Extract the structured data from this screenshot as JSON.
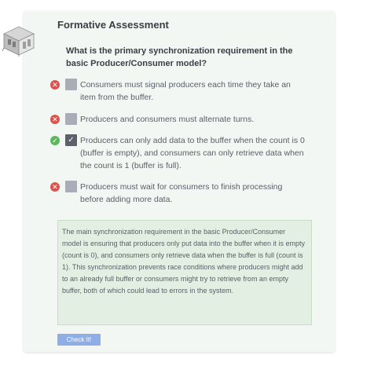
{
  "assessment": {
    "title": "Formative Assessment",
    "question": "What is the primary synchronization requirement in the basic Producer/Consumer model?",
    "options": [
      {
        "label": "Consumers must signal producers each time they take an item from the buffer.",
        "correct": false,
        "checked": false
      },
      {
        "label": "Producers and consumers must alternate turns.",
        "correct": false,
        "checked": false
      },
      {
        "label": "Producers can only add data to the buffer when the count is 0 (buffer is empty), and consumers can only retrieve data when the count is 1 (buffer is full).",
        "correct": true,
        "checked": true
      },
      {
        "label": "Producers must wait for consumers to finish processing before adding more data.",
        "correct": false,
        "checked": false
      }
    ],
    "explanation": "The main synchronization requirement in the basic Producer/Consumer model is ensuring that producers only put data into the buffer when it is empty (count is 0), and consumers only retrieve data when the buffer is full (count is 1). This synchronization prevents race conditions where producers might add to an already full buffer or consumers might try to retrieve from an empty buffer, both of which could lead to errors in the system.",
    "check_button_label": "Check It!",
    "icons": {
      "wrong": "x-circle-icon",
      "correct": "check-circle-icon",
      "checkbox_checked": "checkmark-icon",
      "logo": "cube-icon"
    }
  },
  "colors": {
    "card_background": "#f2f7f3",
    "explanation_background": "#e3efe2",
    "wrong": "#d9534f",
    "correct": "#5cb85c",
    "button": "#8faee8"
  }
}
